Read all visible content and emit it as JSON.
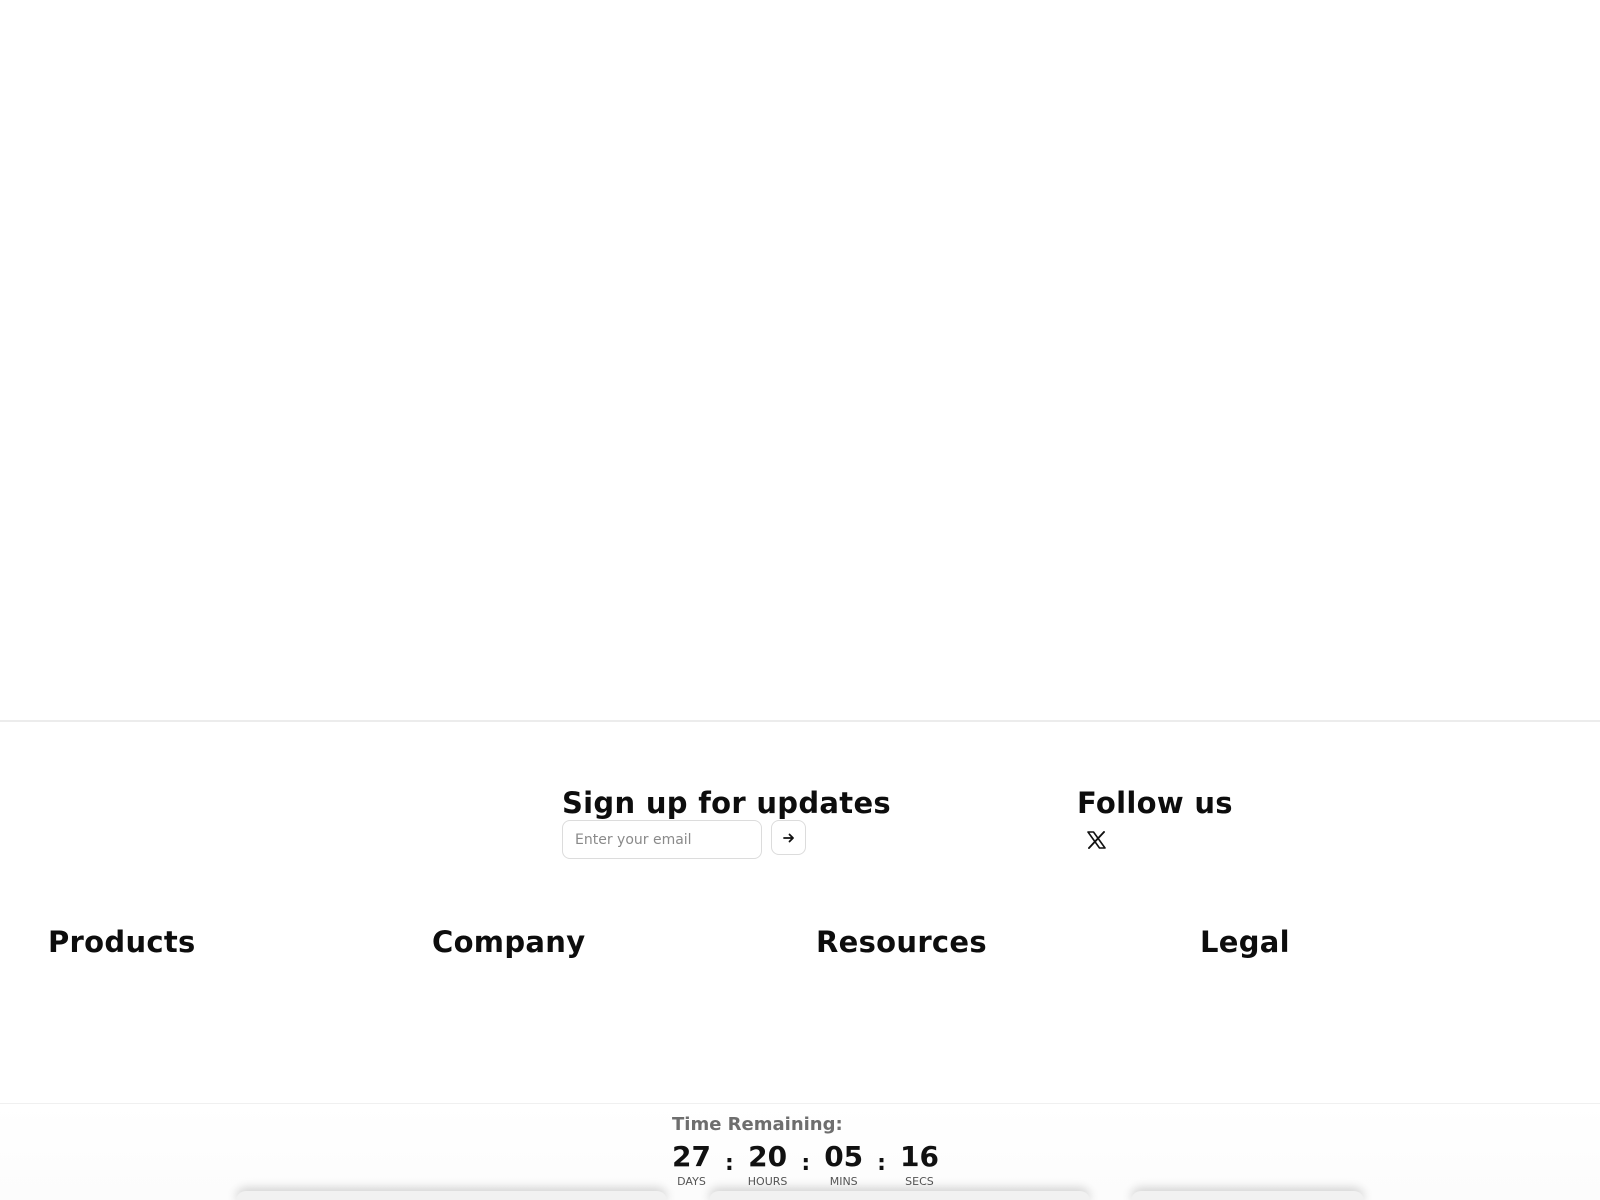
{
  "signup": {
    "heading": "Sign up for updates",
    "email_placeholder": "Enter your email",
    "submit_icon": "arrow-right-icon"
  },
  "follow": {
    "heading": "Follow us",
    "social_icon": "x-logo-icon"
  },
  "footer_columns": [
    {
      "heading": "Products"
    },
    {
      "heading": "Company"
    },
    {
      "heading": "Resources"
    },
    {
      "heading": "Legal"
    }
  ],
  "countdown": {
    "label": "Time Remaining:",
    "units": [
      {
        "value": "27",
        "label": "DAYS"
      },
      {
        "value": "20",
        "label": "HOURS"
      },
      {
        "value": "05",
        "label": "MINS"
      },
      {
        "value": "16",
        "label": "SECS"
      }
    ],
    "separator": ":"
  }
}
